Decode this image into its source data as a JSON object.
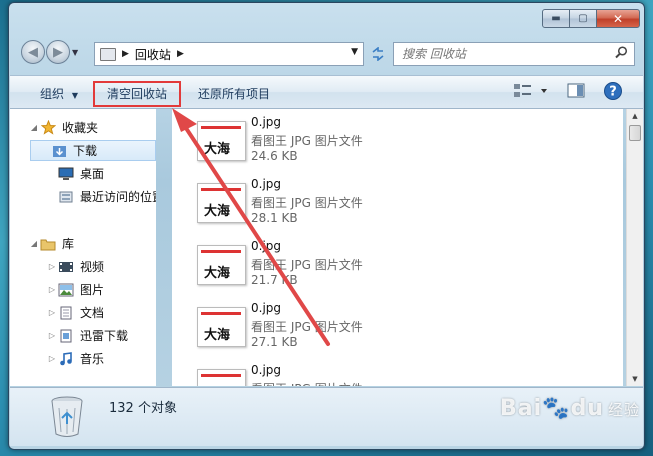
{
  "window": {
    "title_path": "回收站",
    "caption": {
      "minimize": "▬",
      "maximize": "▢",
      "close": "✕"
    }
  },
  "address_bar": {
    "path_root": "回收站"
  },
  "search": {
    "placeholder": "搜索 回收站"
  },
  "toolbar": {
    "organize_label": "组织",
    "empty_bin_label": "清空回收站",
    "restore_all_label": "还原所有项目"
  },
  "nav_pane": {
    "favorites_label": "收藏夹",
    "favorites": [
      "下载",
      "桌面",
      "最近访问的位置"
    ],
    "libraries_label": "库",
    "libraries": [
      "视频",
      "图片",
      "文档",
      "迅雷下载",
      "音乐"
    ]
  },
  "files": [
    {
      "name": "0.jpg",
      "type": "看图王 JPG 图片文件",
      "size": "24.6 KB"
    },
    {
      "name": "0.jpg",
      "type": "看图王 JPG 图片文件",
      "size": "28.1 KB"
    },
    {
      "name": "0.jpg",
      "type": "看图王 JPG 图片文件",
      "size": "21.7 KB"
    },
    {
      "name": "0.jpg",
      "type": "看图王 JPG 图片文件",
      "size": "27.1 KB"
    },
    {
      "name": "0.jpg",
      "type": "看图王 JPG 图片文件",
      "size": ""
    }
  ],
  "thumb_calligraphy": "大海",
  "status": {
    "count_text": "132 个对象"
  },
  "watermark": {
    "brand": "Bai",
    "paw": "du",
    "suffix": "经验"
  },
  "colors": {
    "highlight": "#e23a3a",
    "arrow": "#e04848"
  }
}
